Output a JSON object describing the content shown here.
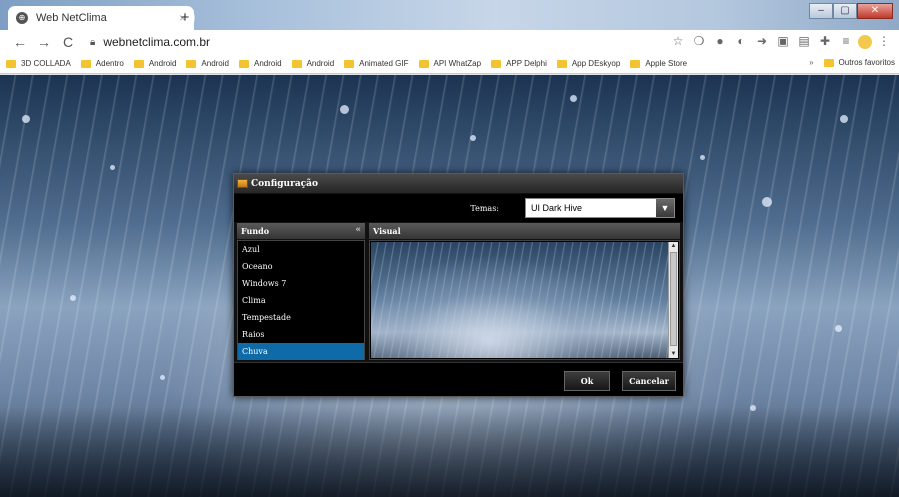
{
  "browser": {
    "tab_title": "Web NetClima",
    "tab_close": "×",
    "new_tab": "+",
    "back": "←",
    "forward": "→",
    "reload": "C",
    "url": "webnetclima.com.br",
    "star": "☆"
  },
  "bookmarks": {
    "items": [
      "3D COLLADA",
      "Adentro",
      "Android",
      "Android",
      "Android",
      "Android",
      "Animated GIF",
      "API WhatZap",
      "APP Delphi",
      "App DEskyop",
      "Apple Store"
    ],
    "more": "»",
    "other": "Outros favoritos"
  },
  "dialog": {
    "title": "Configuração",
    "themes_label": "Temas:",
    "theme_value": "UI Dark Hive",
    "fundo_header": "Fundo",
    "collapse": "«",
    "visual_header": "Visual",
    "backgrounds": [
      "Azul",
      "Oceano",
      "Windows 7",
      "Clima",
      "Tempestade",
      "Raios",
      "Chuva"
    ],
    "selected_index": 6,
    "ok": "Ok",
    "cancel": "Cancelar"
  }
}
